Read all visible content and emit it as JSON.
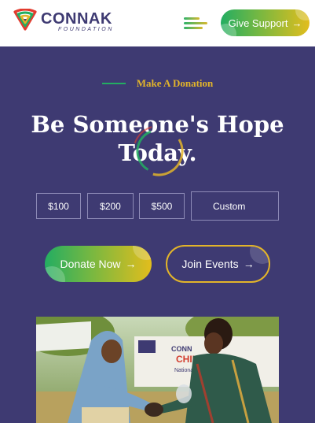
{
  "header": {
    "logo_name": "CONNAK",
    "logo_sub": "FOUNDATION",
    "support_label": "Give Support",
    "support_arrow": "→",
    "menu_icon": "hamburger-icon"
  },
  "hero": {
    "eyebrow": "Make A Donation",
    "title": "Be Someone's Hope Today."
  },
  "amounts": [
    {
      "label": "$100"
    },
    {
      "label": "$200"
    },
    {
      "label": "$500"
    }
  ],
  "custom_placeholder": "Custom",
  "actions": {
    "donate_label": "Donate Now",
    "join_label": "Join Events",
    "arrow": "→"
  },
  "photo_text": {
    "banner_line1": "CONN",
    "banner_line2": "CHILDR",
    "banner_line3": "National Chil"
  },
  "colors": {
    "primary": "#3e3a72",
    "green": "#23ad62",
    "gold": "#e2b42a"
  }
}
